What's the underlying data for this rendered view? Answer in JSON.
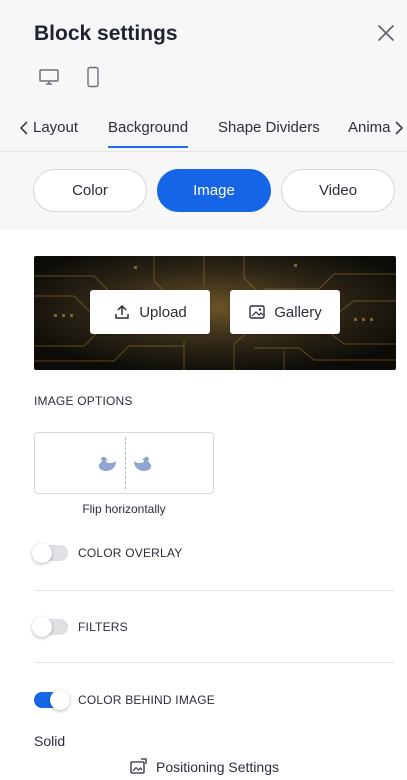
{
  "header": {
    "title": "Block settings"
  },
  "tabs": [
    {
      "label": "Layout"
    },
    {
      "label": "Background"
    },
    {
      "label": "Shape Dividers"
    },
    {
      "label": "Anima"
    }
  ],
  "segments": [
    {
      "label": "Color"
    },
    {
      "label": "Image"
    },
    {
      "label": "Video"
    }
  ],
  "image": {
    "upload_label": "Upload",
    "gallery_label": "Gallery"
  },
  "image_options": {
    "section_label": "IMAGE OPTIONS",
    "flip_caption": "Flip horizontally"
  },
  "toggles": {
    "color_overlay": {
      "label": "COLOR OVERLAY",
      "on": false
    },
    "filters": {
      "label": "FILTERS",
      "on": false
    },
    "color_behind_image": {
      "label": "COLOR BEHIND IMAGE",
      "on": true
    }
  },
  "fill_type": "Solid",
  "footer": {
    "label": "Positioning Settings"
  },
  "colors": {
    "accent": "#1565e6",
    "text": "#1f2330"
  }
}
